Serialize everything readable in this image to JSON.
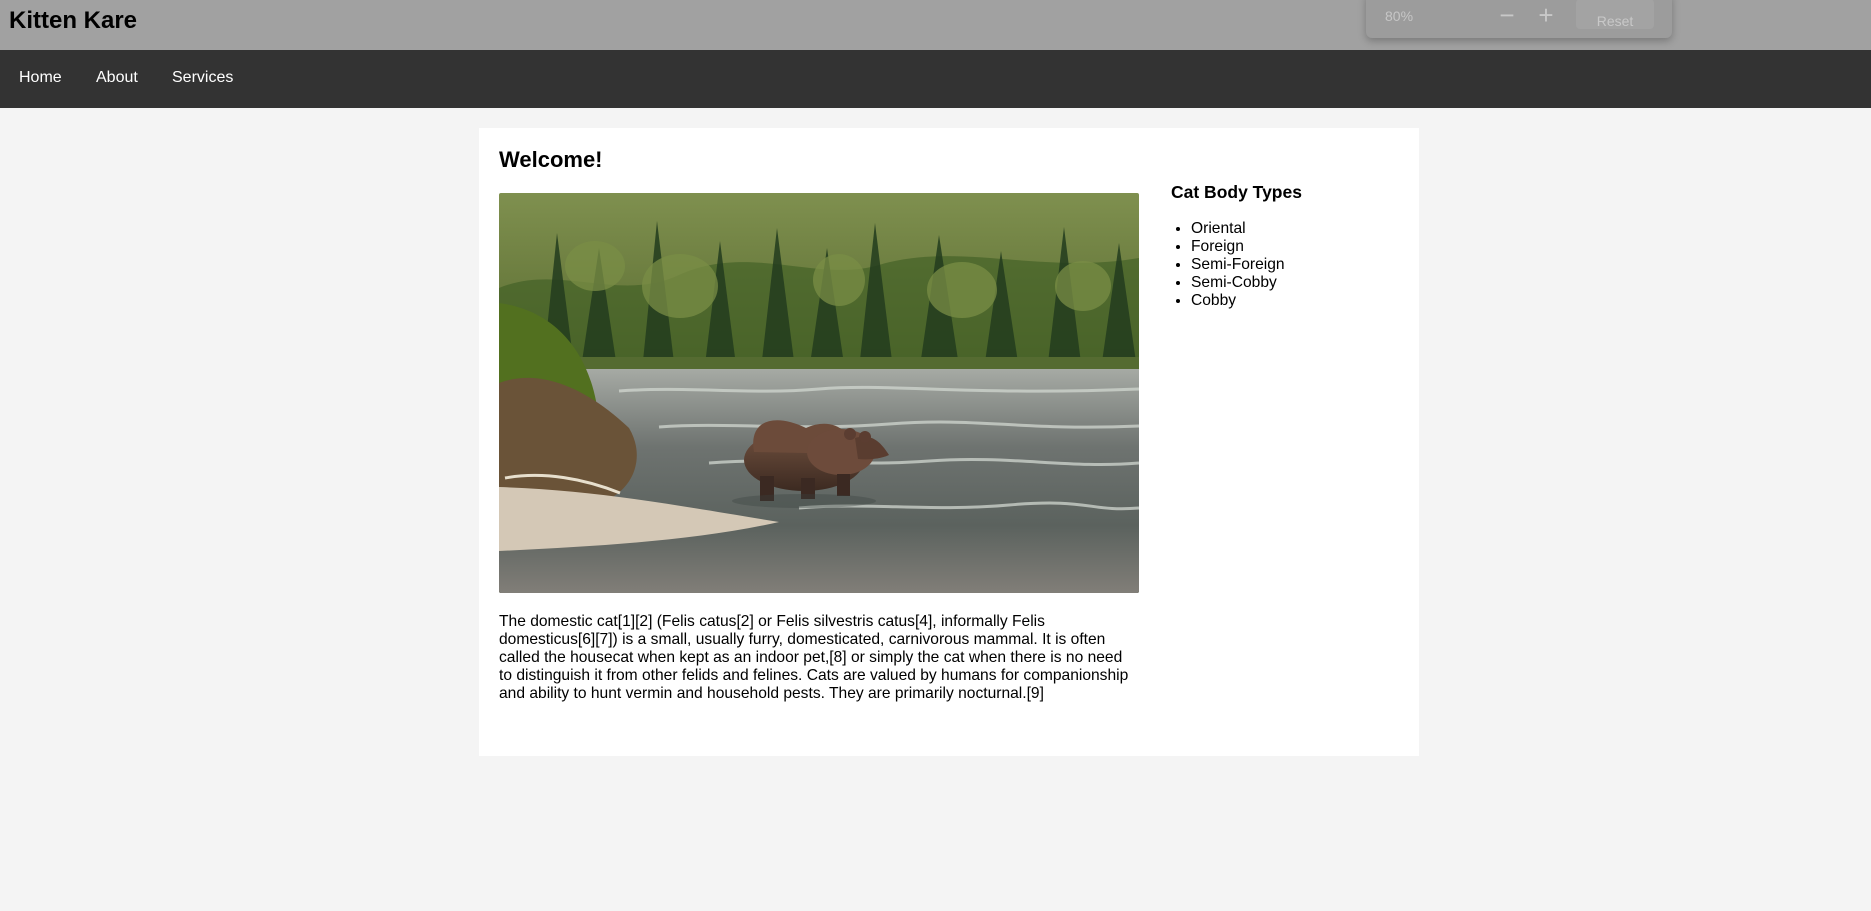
{
  "header": {
    "title": "Kitten Kare"
  },
  "zoom_popup": {
    "zoom_level": "80%",
    "decrease_label": "−",
    "increase_label": "+",
    "reset_label": "Reset"
  },
  "nav": {
    "items": [
      {
        "label": "Home"
      },
      {
        "label": "About"
      },
      {
        "label": "Services"
      }
    ]
  },
  "main": {
    "heading": "Welcome!",
    "image": {
      "icon": "bear-in-river-photo"
    },
    "paragraph": "The domestic cat[1][2] (Felis catus[2] or Felis silvestris catus[4], informally Felis domesticus[6][7]) is a small, usually furry, domesticated, carnivorous mammal. It is often called the housecat when kept as an indoor pet,[8] or simply the cat when there is no need to distinguish it from other felids and felines. Cats are valued by humans for companionship and ability to hunt vermin and household pests. They are primarily nocturnal.[9]"
  },
  "sidebar": {
    "heading": "Cat Body Types",
    "items": [
      {
        "label": "Oriental"
      },
      {
        "label": "Foreign"
      },
      {
        "label": "Semi-Foreign"
      },
      {
        "label": "Semi-Cobby"
      },
      {
        "label": "Cobby"
      }
    ]
  },
  "colors": {
    "header_background": "#a1a1a1",
    "nav_background": "#333333",
    "page_background": "#f4f4f4",
    "card_background": "#ffffff"
  }
}
